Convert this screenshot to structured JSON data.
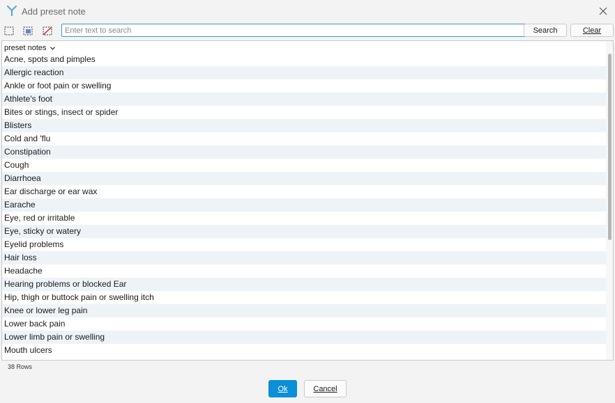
{
  "window": {
    "title": "Add preset note",
    "app_icon": "app-logo-icon",
    "close_icon": "close-icon"
  },
  "toolbar": {
    "icons": [
      "select-all-icon",
      "select-range-icon",
      "deselect-icon"
    ],
    "search_placeholder": "Enter text to search",
    "search_value": "",
    "search_label": "Search",
    "clear_label": "Clear"
  },
  "list": {
    "header": "preset notes",
    "header_icon": "chevron-down-icon",
    "rows": [
      "Acne, spots and pimples",
      "Allergic reaction",
      "Ankle or foot pain or swelling",
      "Athlete's foot",
      "Bites or stings, insect or spider",
      "Blisters",
      "Cold and 'flu",
      "Constipation",
      "Cough",
      "Diarrhoea",
      "Ear discharge or ear wax",
      "Earache",
      "Eye, red or irritable",
      "Eye, sticky or watery",
      "Eyelid problems",
      "Hair loss",
      "Headache",
      "Hearing problems or blocked Ear",
      "Hip, thigh or buttock pain or swelling itch",
      "Knee or lower leg pain",
      "Lower back pain",
      "Lower limb pain or swelling",
      "Mouth ulcers"
    ],
    "row_count": "38 Rows"
  },
  "actions": {
    "ok_label": "Ok",
    "cancel_label": "Cancel"
  },
  "colors": {
    "accent": "#0b8fd6",
    "row_alt": "#eef3f8",
    "input_border": "#3a9bb8"
  }
}
